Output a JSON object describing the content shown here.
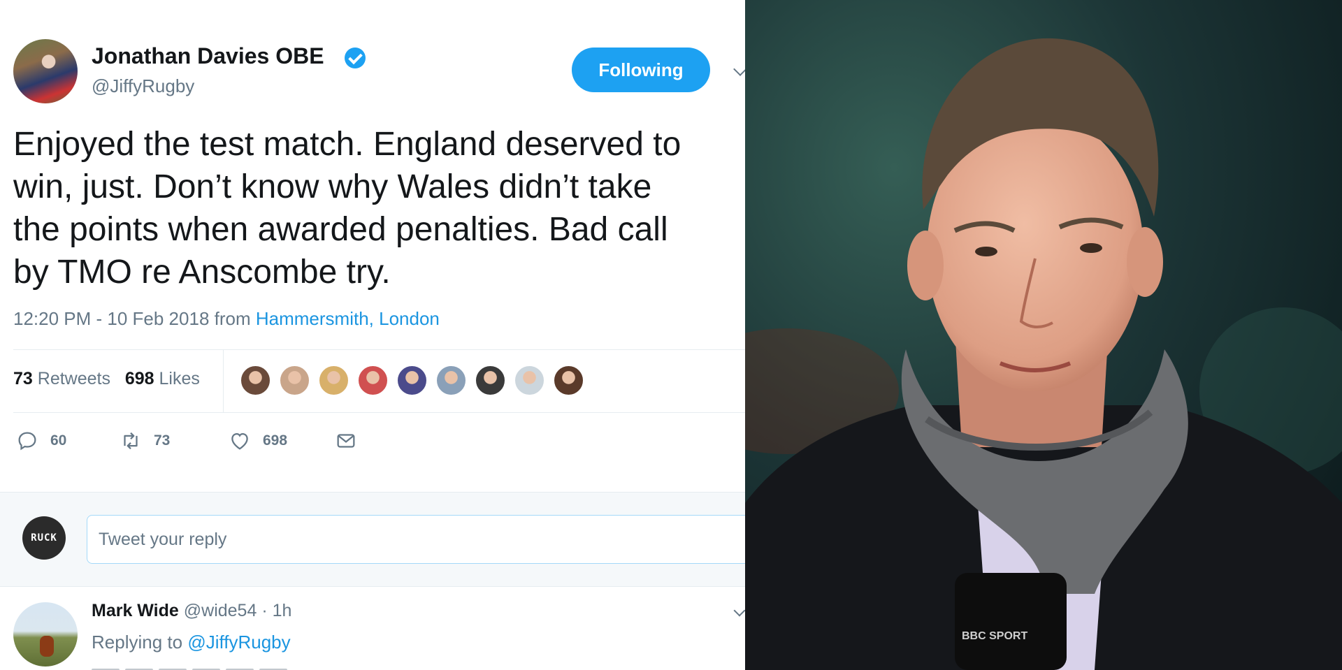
{
  "tweet": {
    "author_name": "Jonathan Davies OBE",
    "author_handle": "@JiffyRugby",
    "follow_label": "Following",
    "text_lines": [
      "Enjoyed the test match. England deserved to",
      "win, just. Don’t know why Wales didn’t take",
      "the points when awarded penalties. Bad call",
      "by TMO re Anscombe try."
    ],
    "time": "12:20 PM - 10 Feb 2018",
    "from_label": "from",
    "location": "Hammersmith, London",
    "retweets_count": "73",
    "retweets_label": "Retweets",
    "likes_count": "698",
    "likes_label": "Likes",
    "liker_colors": [
      "#6a4a3a",
      "#c9a58a",
      "#d8b06a",
      "#d05050",
      "#4b4b8b",
      "#8aa0b8",
      "#3a3a3a",
      "#ccd6dd",
      "#5a3a2a"
    ]
  },
  "actions": {
    "reply_count": "60",
    "retweet_count": "73",
    "like_count": "698"
  },
  "reply_box": {
    "avatar_text": "RUCK",
    "placeholder": "Tweet your reply"
  },
  "reply": {
    "name": "Mark Wide",
    "handle_time": "@wide54 · 1h",
    "replying_label": "Replying to",
    "replying_handle": "@JiffyRugby"
  },
  "photo": {
    "mic_label": "BBC SPORT",
    "colors": {
      "background": "#1d3b3d",
      "coat": "#15171b",
      "scarf": "#6b6d70",
      "shirt": "#d8d2ea",
      "skin": "#e6ad92",
      "hair": "#5b4a3a"
    }
  },
  "colors": {
    "accent": "#1da1f2",
    "link": "#1b95e0",
    "muted": "#657786"
  }
}
